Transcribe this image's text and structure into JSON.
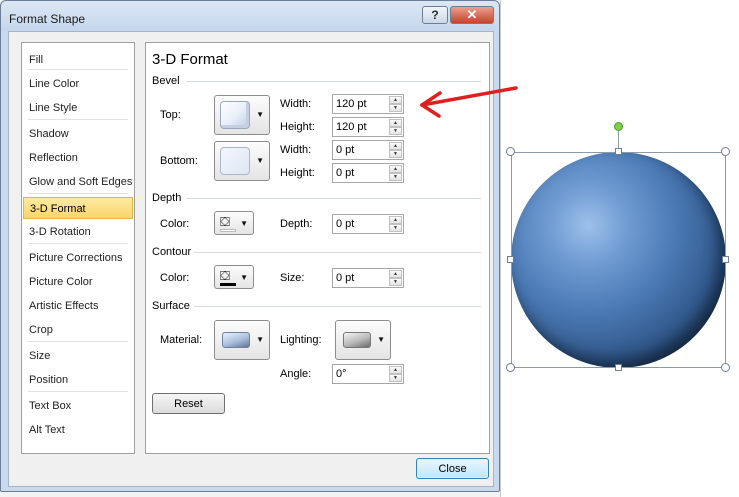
{
  "window": {
    "title": "Format Shape",
    "help_label": "?",
    "close_label": "✕"
  },
  "nav": [
    {
      "label": "Fill",
      "selected": false
    },
    {
      "label": "Line Color",
      "selected": false
    },
    {
      "label": "Line Style",
      "selected": false
    },
    {
      "label": "Shadow",
      "selected": false
    },
    {
      "label": "Reflection",
      "selected": false
    },
    {
      "label": "Glow and Soft Edges",
      "selected": false
    },
    {
      "label": "3-D Format",
      "selected": true
    },
    {
      "label": "3-D Rotation",
      "selected": false
    },
    {
      "label": "Picture Corrections",
      "selected": false
    },
    {
      "label": "Picture Color",
      "selected": false
    },
    {
      "label": "Artistic Effects",
      "selected": false
    },
    {
      "label": "Crop",
      "selected": false
    },
    {
      "label": "Size",
      "selected": false
    },
    {
      "label": "Position",
      "selected": false
    },
    {
      "label": "Text Box",
      "selected": false
    },
    {
      "label": "Alt Text",
      "selected": false
    }
  ],
  "panel": {
    "title": "3-D Format",
    "bevel": {
      "heading": "Bevel",
      "top_label": "Top:",
      "bottom_label": "Bottom:",
      "top_width_label": "Width:",
      "top_width": "120 pt",
      "top_height_label": "Height:",
      "top_height": "120 pt",
      "bottom_width_label": "Width:",
      "bottom_width": "0 pt",
      "bottom_height_label": "Height:",
      "bottom_height": "0 pt"
    },
    "depth": {
      "heading": "Depth",
      "color_label": "Color:",
      "depth_label": "Depth:",
      "depth_value": "0 pt"
    },
    "contour": {
      "heading": "Contour",
      "color_label": "Color:",
      "size_label": "Size:",
      "size_value": "0 pt"
    },
    "surface": {
      "heading": "Surface",
      "material_label": "Material:",
      "lighting_label": "Lighting:",
      "angle_label": "Angle:",
      "angle_value": "0°"
    },
    "reset_label": "Reset"
  },
  "footer": {
    "close_label": "Close"
  },
  "colors": {
    "selection": "#f8d56a",
    "sphere": "#4a78b3",
    "arrow": "#e02020"
  }
}
